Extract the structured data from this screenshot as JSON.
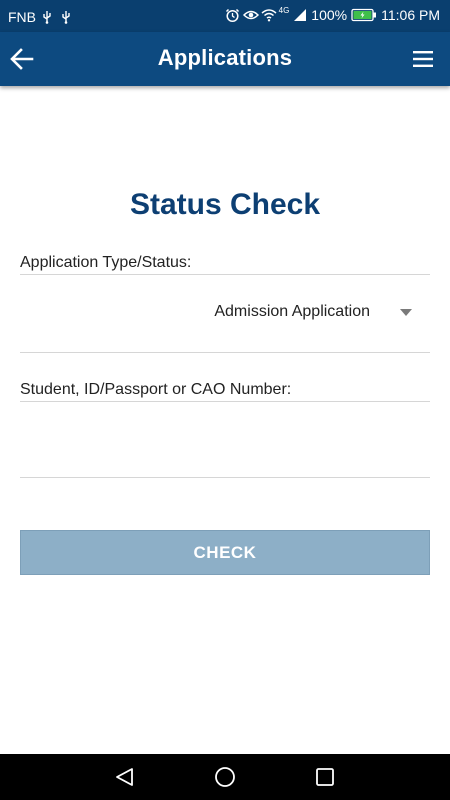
{
  "status_bar": {
    "carrier": "FNB",
    "network": "4G",
    "battery_percent": "100%",
    "time": "11:06 PM",
    "battery_level": 1.0,
    "icons": [
      "usb-icon",
      "usb-icon",
      "alarm-icon",
      "eye-icon",
      "wifi-icon",
      "signal-icon",
      "battery-charging-icon"
    ]
  },
  "app_bar": {
    "title": "Applications",
    "back_icon": "arrow-left-icon",
    "menu_icon": "hamburger-menu-icon"
  },
  "form": {
    "heading": "Status Check",
    "application_type_label": "Application Type/Status:",
    "application_type_value": "Admission Application",
    "student_id_label": "Student, ID/Passport or CAO Number:",
    "student_id_value": "",
    "check_button_label": "CHECK"
  },
  "nav_bar": {
    "icons": [
      "back-triangle-icon",
      "home-circle-icon",
      "recents-square-icon"
    ]
  },
  "colors": {
    "status_bar": "#0a3f6f",
    "app_bar": "#0d4a80",
    "heading": "#0d3f73",
    "button": "#8dafc7"
  }
}
